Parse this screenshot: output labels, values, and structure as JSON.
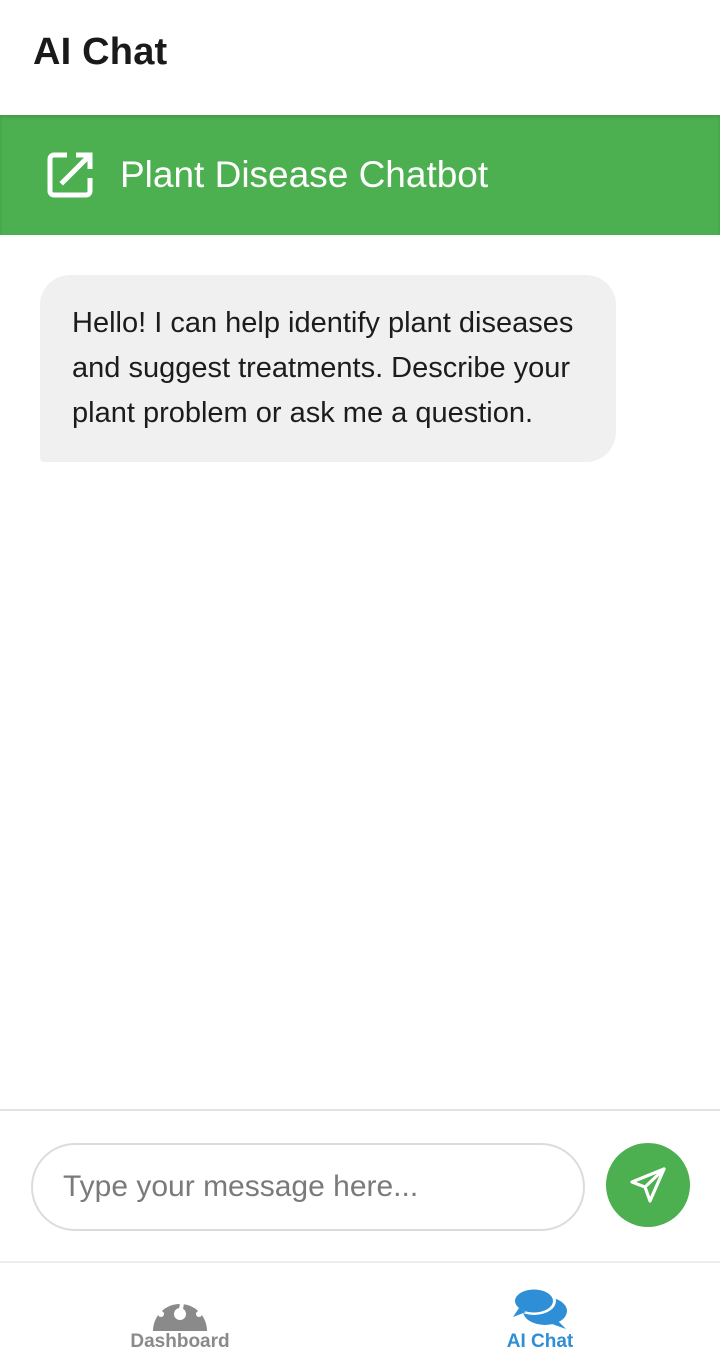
{
  "app_bar": {
    "title": "AI Chat"
  },
  "chat_header": {
    "title": "Plant Disease Chatbot",
    "icon": "open-in-new-icon",
    "color": "#4caf50"
  },
  "messages": [
    {
      "sender": "bot",
      "text": "Hello! I can help identify plant diseases and suggest treatments. Describe your plant problem or ask me a question."
    }
  ],
  "input": {
    "placeholder": "Type your message here...",
    "value": ""
  },
  "send_button": {
    "icon": "send-icon",
    "color": "#4caf50"
  },
  "bottom_nav": {
    "items": [
      {
        "label": "Dashboard",
        "icon": "dashboard-gauge-icon",
        "active": false,
        "color": "#8a8a8a"
      },
      {
        "label": "AI Chat",
        "icon": "chat-bubbles-icon",
        "active": true,
        "color": "#2e8fd6"
      }
    ]
  }
}
